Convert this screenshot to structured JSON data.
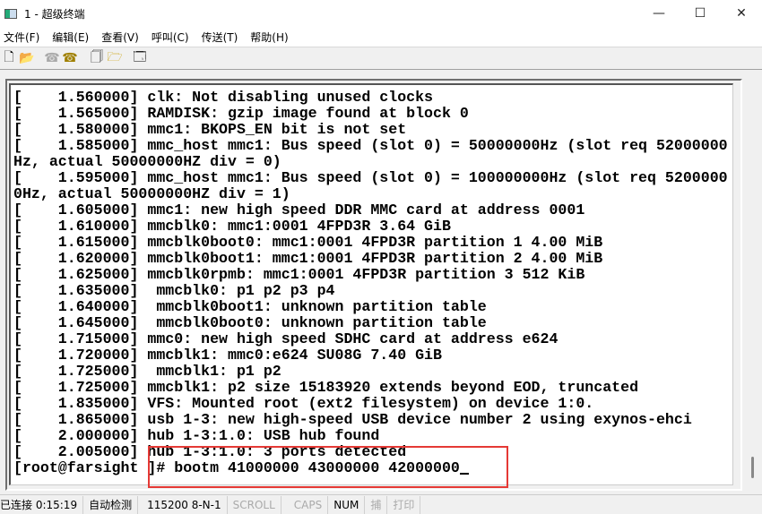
{
  "window": {
    "title": "1 - 超级终端",
    "minimize": "—",
    "maximize": "☐",
    "close": "✕"
  },
  "menu": [
    "文件(F)",
    "编辑(E)",
    "查看(V)",
    "呼叫(C)",
    "传送(T)",
    "帮助(H)"
  ],
  "toolbar": [
    "new-icon",
    "open-icon",
    "disconnect-icon",
    "call-icon",
    "send-file-icon",
    "receive-file-icon",
    "properties-icon"
  ],
  "terminal": {
    "lines": [
      "[    1.560000] clk: Not disabling unused clocks",
      "[    1.565000] RAMDISK: gzip image found at block 0",
      "[    1.580000] mmc1: BKOPS_EN bit is not set",
      "[    1.585000] mmc_host mmc1: Bus speed (slot 0) = 50000000Hz (slot req 52000000",
      "Hz, actual 50000000HZ div = 0)",
      "[    1.595000] mmc_host mmc1: Bus speed (slot 0) = 100000000Hz (slot req 5200000",
      "0Hz, actual 50000000HZ div = 1)",
      "[    1.605000] mmc1: new high speed DDR MMC card at address 0001",
      "[    1.610000] mmcblk0: mmc1:0001 4FPD3R 3.64 GiB",
      "[    1.615000] mmcblk0boot0: mmc1:0001 4FPD3R partition 1 4.00 MiB",
      "[    1.620000] mmcblk0boot1: mmc1:0001 4FPD3R partition 2 4.00 MiB",
      "[    1.625000] mmcblk0rpmb: mmc1:0001 4FPD3R partition 3 512 KiB",
      "[    1.635000]  mmcblk0: p1 p2 p3 p4",
      "[    1.640000]  mmcblk0boot1: unknown partition table",
      "[    1.645000]  mmcblk0boot0: unknown partition table",
      "[    1.715000] mmc0: new high speed SDHC card at address e624",
      "[    1.720000] mmcblk1: mmc0:e624 SU08G 7.40 GiB",
      "[    1.725000]  mmcblk1: p1 p2",
      "[    1.725000] mmcblk1: p2 size 15183920 extends beyond EOD, truncated",
      "[    1.835000] VFS: Mounted root (ext2 filesystem) on device 1:0.",
      "[    1.865000] usb 1-3: new high-speed USB device number 2 using exynos-ehci",
      "[    2.000000] hub 1-3:1.0: USB hub found",
      "[    2.005000] hub 1-3:1.0: 3 ports detected",
      "[root@farsight ]# bootm 41000000 43000000 42000000"
    ]
  },
  "status": {
    "connected": "已连接 0:15:19",
    "detect": "自动检测",
    "port": "115200 8-N-1",
    "scroll": "SCROLL",
    "caps": "CAPS",
    "num": "NUM",
    "capture": "捕",
    "print": "打印"
  },
  "colors": {
    "highlight": "#e53935"
  }
}
